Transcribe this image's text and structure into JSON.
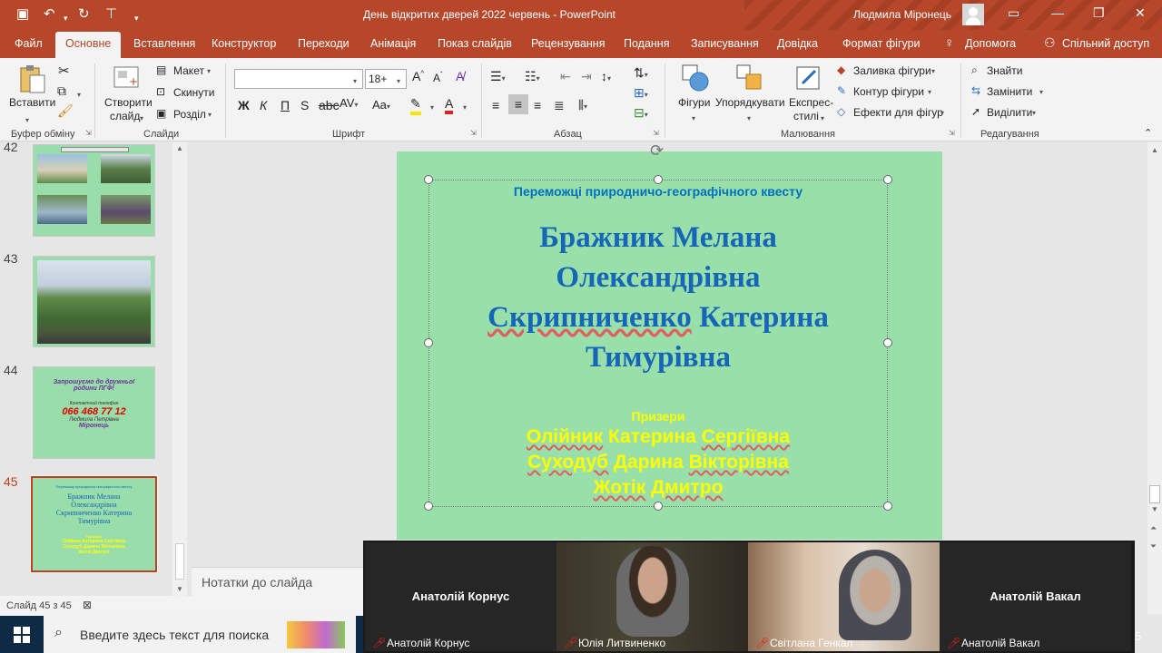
{
  "titlebar": {
    "document_title": "День відкритих дверей 2022 червень  -  PowerPoint",
    "user_name": "Людмила Міронець",
    "accent_color": "#b7472a"
  },
  "tabs": [
    "Файл",
    "Основне",
    "Вставлення",
    "Конструктор",
    "Переходи",
    "Анімація",
    "Показ слайдів",
    "Рецензування",
    "Подання",
    "Записування",
    "Довідка",
    "Формат фігури",
    "Допомога",
    "Спільний доступ"
  ],
  "ribbon": {
    "clipboard": {
      "paste": "Вставити",
      "group": "Буфер обміну"
    },
    "slides": {
      "new_slide_line1": "Створити",
      "new_slide_line2": "слайд",
      "layout": "Макет",
      "reset": "Скинути",
      "section": "Розділ",
      "group": "Слайди"
    },
    "font": {
      "font_name": "",
      "font_size": "18+",
      "group": "Шрифт"
    },
    "paragraph": {
      "group": "Абзац"
    },
    "drawing": {
      "shapes": "Фігури",
      "arrange": "Упорядкувати",
      "quick_styles_line1": "Експрес-",
      "quick_styles_line2": "стилі",
      "shape_fill": "Заливка фігури",
      "shape_outline": "Контур фігури",
      "shape_effects": "Ефекти для фігур",
      "group": "Малювання"
    },
    "editing": {
      "find": "Знайти",
      "replace": "Замінити",
      "select": "Виділити",
      "group": "Редагування"
    }
  },
  "thumbnails": [
    {
      "number": "42"
    },
    {
      "number": "43"
    },
    {
      "number": "44",
      "line1": "Запрошуємо до  дружньої",
      "line2": "родини ПГФ!",
      "line3": "Контактний телефон",
      "phone": "066 468 77 12",
      "line5": "Людмила Петрівна",
      "line6": "Міронець"
    },
    {
      "number": "45"
    }
  ],
  "slide": {
    "subtitle": "Переможці природничо-географічного квесту",
    "winners": [
      "Бражник Мелана",
      "Олександрівна",
      "Скрипниченко",
      "Катерина",
      "Тимурівна"
    ],
    "prizes_heading": "Призери",
    "prizes": [
      {
        "surname": "Олійник",
        "name": "Катерина",
        "patronymic": "Сергіївна"
      },
      {
        "surname": "Суходуб",
        "name": "Дарина",
        "patronymic": "Вікторівна"
      },
      {
        "surname": "Жотік",
        "name": "Дмитро",
        "patronymic": ""
      }
    ],
    "background_color": "#99dfa9"
  },
  "notes_placeholder": "Нотатки до слайда",
  "status": {
    "slide_counter": "Слайд 45 з 45"
  },
  "video_participants": [
    {
      "display": "Анатолій Корнус",
      "label": "Анатолій Корнус",
      "has_video": false
    },
    {
      "display": "",
      "label": "Юлія Литвиненко",
      "has_video": true
    },
    {
      "display": "",
      "label": "Світлана Генкал",
      "has_video": true
    },
    {
      "display": "Анатолій Вакал",
      "label": "Анатолій Вакал",
      "has_video": false
    }
  ],
  "taskbar": {
    "search_placeholder": "Введите здесь текст для поиска"
  }
}
